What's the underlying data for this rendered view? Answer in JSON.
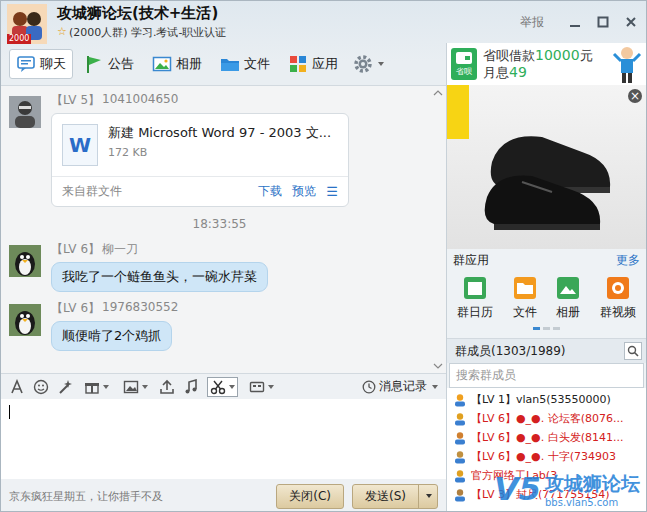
{
  "window": {
    "title": "攻城狮论坛(技术+生活)",
    "star": "☆",
    "subtitle": "(2000人群) 学习.考试-职业认证",
    "avatar_badge": "2000",
    "report": "举报"
  },
  "tabs": [
    {
      "label": "聊天",
      "selected": true
    },
    {
      "label": "公告",
      "selected": false
    },
    {
      "label": "相册",
      "selected": false
    },
    {
      "label": "文件",
      "selected": false
    },
    {
      "label": "应用",
      "selected": false
    }
  ],
  "chat": {
    "messages": [
      {
        "kind": "file",
        "level": "【LV 5】",
        "sender": "1041004650",
        "file": {
          "type_letter": "W",
          "name": "新建 Microsoft Word 97 - 2003 文...",
          "size": "172 KB",
          "source": "来自群文件",
          "actions": [
            "下载",
            "预览"
          ],
          "menu": "☰"
        }
      },
      {
        "kind": "time",
        "text": "18:33:55"
      },
      {
        "kind": "text",
        "level": "【LV 6】",
        "sender": "柳一刀",
        "text": "我吃了一个鲢鱼鱼头，一碗水芹菜"
      },
      {
        "kind": "text",
        "level": "【LV 6】",
        "sender": "1976830552",
        "text": "顺便啃了2个鸡抓"
      }
    ]
  },
  "input_toolbar": {
    "history": "消息记录"
  },
  "footer": {
    "ad_text": "京东疯狂星期五，让你措手不及",
    "buttons": [
      {
        "label": "关闭(C)",
        "dropdown": false
      },
      {
        "label": "发送(S)",
        "dropdown": true
      }
    ]
  },
  "side_ad": {
    "logo_text": "省呗",
    "line1": [
      {
        "text": "省呗借款",
        "highlight": false
      },
      {
        "text": "10000",
        "highlight": true
      },
      {
        "text": "元",
        "highlight": false
      }
    ],
    "line2": [
      {
        "text": "月息",
        "highlight": false
      },
      {
        "text": "49",
        "highlight": true
      }
    ],
    "close": "×"
  },
  "group_apps": {
    "title": "群应用",
    "more": "更多",
    "items": [
      "群日历",
      "文件",
      "相册",
      "群视频"
    ],
    "pages": [
      {
        "selected": true
      },
      {
        "selected": false
      },
      {
        "selected": false
      }
    ]
  },
  "members": {
    "title": "群成员(1303/1989)",
    "search_placeholder": "搜索群成员",
    "items": [
      {
        "level": "【LV 1】",
        "name": "vlan5(53550000)",
        "color": "#222222"
      },
      {
        "level": "【LV 6】",
        "name": "●_●. 论坛客(8076...",
        "color": "#d42020"
      },
      {
        "level": "【LV 6】",
        "name": "●_●. 白头发(8141...",
        "color": "#d42020"
      },
      {
        "level": "【LV 6】",
        "name": "●_●. 十字(734903",
        "color": "#d42020"
      },
      {
        "level": "",
        "name": "官方网络工Lab(3",
        "color": "#d42020"
      },
      {
        "level": "【LV 3】",
        "name": "封尺(771755154)",
        "color": "#d42020"
      }
    ]
  },
  "watermark": {
    "logo": "V5",
    "name": "攻城狮论坛",
    "url": "bbs.vlan5.com"
  }
}
